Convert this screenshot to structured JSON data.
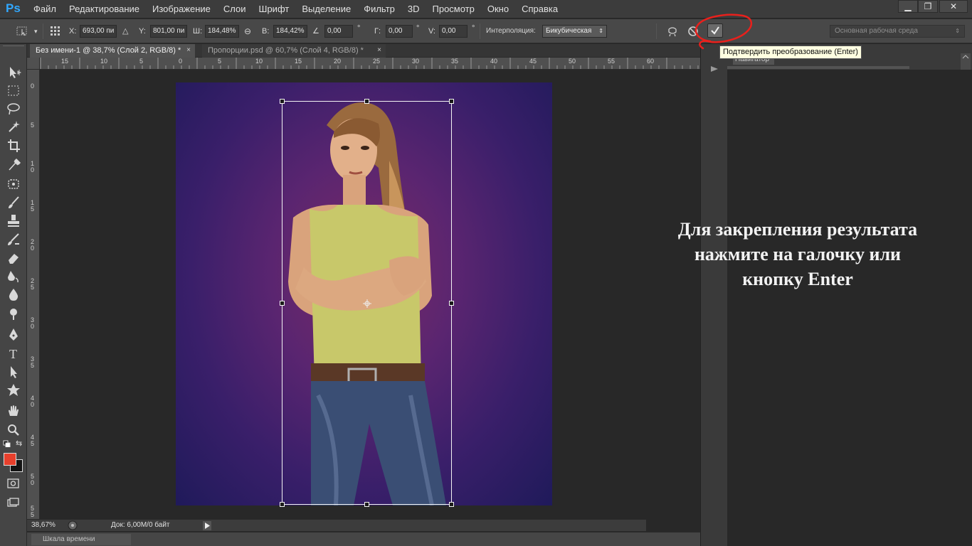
{
  "app": {
    "logo": "Ps"
  },
  "menu": [
    "Файл",
    "Редактирование",
    "Изображение",
    "Слои",
    "Шрифт",
    "Выделение",
    "Фильтр",
    "3D",
    "Просмотр",
    "Окно",
    "Справка"
  ],
  "window_controls": {
    "minimize": "▁",
    "restore": "❐",
    "close": "✕"
  },
  "options": {
    "x_label": "X:",
    "x_value": "693,00 пи",
    "y_label": "Y:",
    "y_value": "801,00 пи",
    "w_label": "Ш:",
    "w_value": "184,48%",
    "h_label": "В:",
    "h_value": "184,42%",
    "angle_value": "0,00",
    "angle_unit": "°",
    "h_skew_label": "Г:",
    "h_skew_value": "0,00",
    "h_skew_unit": "°",
    "v_skew_label": "V:",
    "v_skew_value": "0,00",
    "v_skew_unit": "°",
    "interp_label": "Интерполяция:",
    "interp_value": "Бикубическая",
    "workspace_value": "Основная рабочая среда"
  },
  "tooltip": "Подтвердить преобразование (Enter)",
  "tabs": [
    {
      "label": "Без имени-1 @ 38,7% (Слой 2, RGB/8) *",
      "close": "×",
      "active": true
    },
    {
      "label": "Пропорции.psd @ 60,7% (Слой 4, RGB/8) *",
      "close": "×",
      "active": false
    }
  ],
  "ruler_top": [
    "15",
    "10",
    "5",
    "0",
    "5",
    "10",
    "15",
    "20",
    "25",
    "30",
    "35",
    "40",
    "45",
    "50",
    "55",
    "60"
  ],
  "ruler_left": [
    "0",
    "5",
    "1 0",
    "1 5",
    "2 0",
    "2 5",
    "3 0",
    "3 5",
    "4 0",
    "4 5",
    "5 0",
    "5 5"
  ],
  "instruction": [
    "Для закрепления результата",
    "нажмите на галочку или",
    "кнопку Enter"
  ],
  "status": {
    "zoom": "38,67%",
    "doc": "Док: 6,00M/0 байт"
  },
  "timeline_label": "Шкала времени",
  "navigator_label": "Навигатор",
  "colors": {
    "foreground": "#e8402c",
    "background": "#141414",
    "accent": "#31a8ff",
    "annotation": "#e8201c"
  },
  "tools": [
    "move-icon",
    "marquee-icon",
    "lasso-icon",
    "magic-wand-icon",
    "crop-icon",
    "eyedropper-icon",
    "healing-icon",
    "brush-icon",
    "stamp-icon",
    "history-brush-icon",
    "eraser-icon",
    "gradient-icon",
    "blur-icon",
    "dodge-icon",
    "pen-icon",
    "type-icon",
    "path-select-icon",
    "shape-icon",
    "hand-icon",
    "zoom-icon"
  ]
}
